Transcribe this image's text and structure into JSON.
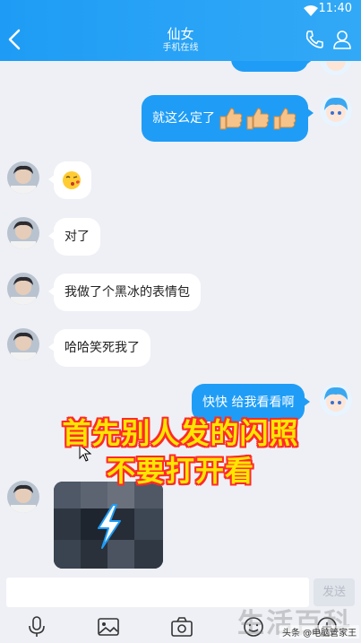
{
  "status": {
    "time": "11:40"
  },
  "header": {
    "title": "仙女",
    "subtitle": "手机在线"
  },
  "messages": [
    {
      "side": "right",
      "text": "就这么定了"
    },
    {
      "side": "left",
      "text": ""
    },
    {
      "side": "left",
      "text": "对了"
    },
    {
      "side": "left",
      "text": "我做了个黑冰的表情包"
    },
    {
      "side": "left",
      "text": "哈哈笑死我了"
    },
    {
      "side": "right",
      "text": "快快 给我看看啊"
    }
  ],
  "overlay": {
    "line1": "首先别人发的闪照",
    "line2": "不要打开看"
  },
  "input": {
    "send_label": "发送"
  },
  "watermark": {
    "big": "生活百科",
    "small": "头条 @电脑管家王"
  },
  "colors": {
    "accent": "#1f9df6",
    "overlay_text": "#ffe600",
    "overlay_outline": "#ff2a2a"
  },
  "icons": [
    "back-arrow-icon",
    "phone-icon",
    "person-icon",
    "emoji-kiss-icon",
    "thumbs-up-icon",
    "flash-icon",
    "microphone-icon",
    "image-icon",
    "camera-icon",
    "emoji-icon",
    "add-icon",
    "wifi-icon"
  ]
}
